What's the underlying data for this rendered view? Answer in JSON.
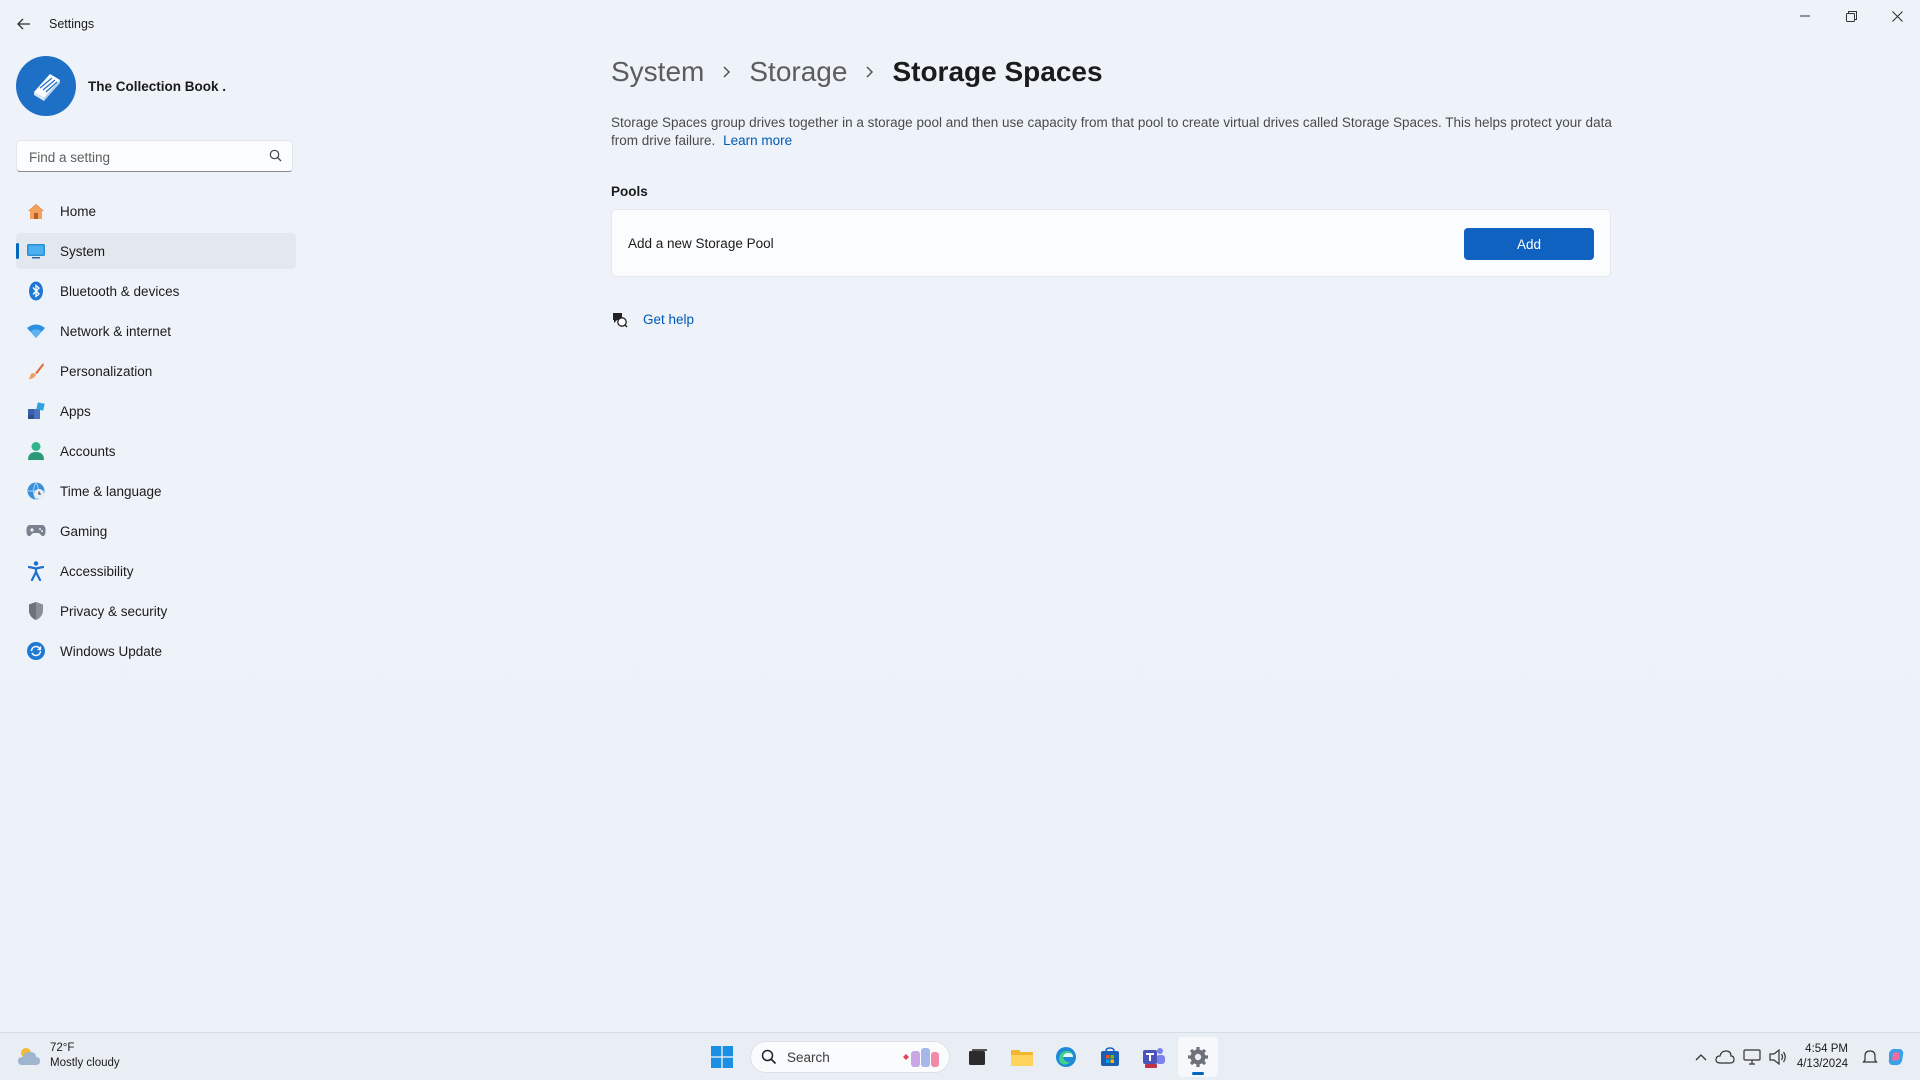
{
  "window": {
    "title": "Settings"
  },
  "profile": {
    "name": "The Collection Book ."
  },
  "search": {
    "placeholder": "Find a setting"
  },
  "sidebar": {
    "items": [
      {
        "label": "Home",
        "icon": "home-icon"
      },
      {
        "label": "System",
        "icon": "system-icon",
        "active": true
      },
      {
        "label": "Bluetooth & devices",
        "icon": "bluetooth-icon"
      },
      {
        "label": "Network & internet",
        "icon": "wifi-icon"
      },
      {
        "label": "Personalization",
        "icon": "brush-icon"
      },
      {
        "label": "Apps",
        "icon": "apps-icon"
      },
      {
        "label": "Accounts",
        "icon": "account-icon"
      },
      {
        "label": "Time & language",
        "icon": "globe-clock-icon"
      },
      {
        "label": "Gaming",
        "icon": "gamepad-icon"
      },
      {
        "label": "Accessibility",
        "icon": "accessibility-icon"
      },
      {
        "label": "Privacy & security",
        "icon": "shield-icon"
      },
      {
        "label": "Windows Update",
        "icon": "update-icon"
      }
    ]
  },
  "breadcrumb": {
    "items": [
      "System",
      "Storage",
      "Storage Spaces"
    ]
  },
  "main": {
    "description": "Storage Spaces group drives together in a storage pool and then use capacity from that pool to create virtual drives called Storage Spaces. This helps protect your data from drive failure.",
    "learn_more": "Learn more",
    "section_title": "Pools",
    "card_label": "Add a new Storage Pool",
    "add_button": "Add",
    "get_help": "Get help"
  },
  "taskbar": {
    "weather_temp": "72°F",
    "weather_desc": "Mostly cloudy",
    "search_label": "Search",
    "time": "4:54 PM",
    "date": "4/13/2024"
  },
  "colors": {
    "accent": "#0067c0",
    "button": "#0f62c0",
    "link": "#0059b5"
  }
}
